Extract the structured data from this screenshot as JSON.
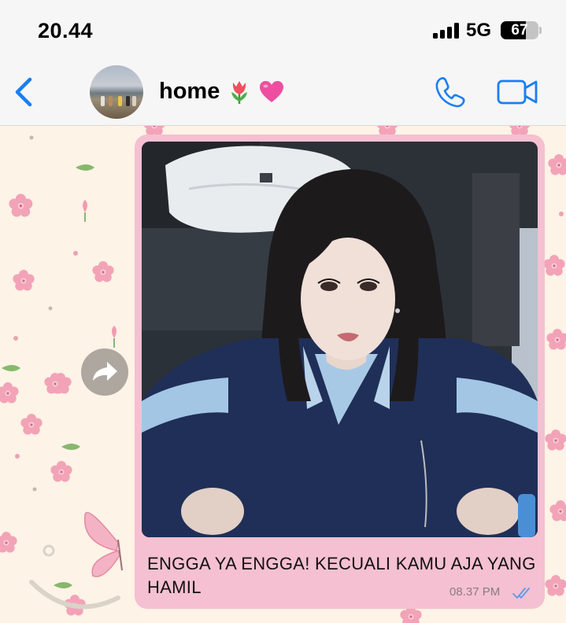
{
  "status_bar": {
    "time": "20.44",
    "network": "5G",
    "battery": 67,
    "battery_label": "67"
  },
  "header": {
    "back_icon": "chevron-left-icon",
    "contact_name": "home",
    "contact_emoji": [
      "tulip-emoji",
      "pink-heart-emoji"
    ],
    "call_icon": "phone-icon",
    "video_icon": "video-camera-icon"
  },
  "message": {
    "type": "image-with-caption",
    "caption": "ENGGA YA ENGGA! KECUALI KAMU AJA YANG HAMIL",
    "time": "08.37 PM",
    "status_icon": "double-check-read-icon",
    "forward_icon": "forward-arrow-icon"
  },
  "colors": {
    "accent": "#1a7ef2",
    "bubble": "#f5c0d2",
    "wallpaper": "#fdf3e6",
    "read_ticks": "#5b9ae8"
  }
}
